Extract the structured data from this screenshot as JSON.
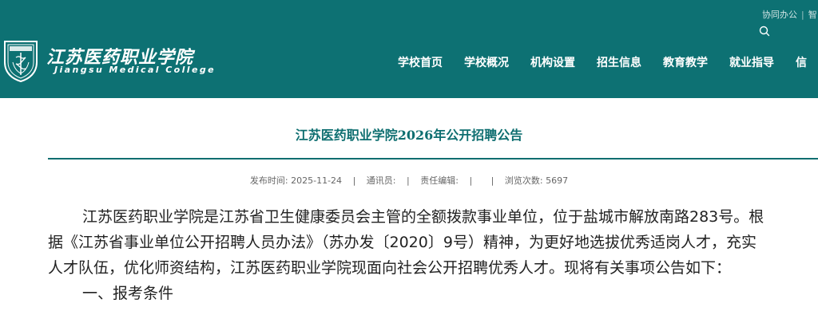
{
  "header": {
    "school_name_cn": "江苏医药职业学院",
    "school_name_en": "Jiangsu Medical College",
    "top_links": [
      "协同办公",
      "智"
    ],
    "nav": [
      "学校首页",
      "学校概况",
      "机构设置",
      "招生信息",
      "教育教学",
      "就业指导",
      "信"
    ]
  },
  "article": {
    "title": "江苏医药职业学院2026年公开招聘公告",
    "meta": {
      "publish_label": "发布时间:",
      "publish_date": "2025-11-24",
      "reporter_label": "通讯员:",
      "reporter": "",
      "editor_label": "责任编辑:",
      "editor": "",
      "views_label": "浏览次数:",
      "views": "5697"
    },
    "lines": [
      "江苏医药职业学院是江苏省卫生健康委员会主管的全额拨款事业单位，位于盐城市解放南路283号。根",
      "据《江苏省事业单位公开招聘人员办法》（苏办发〔2020〕9号）精神，为更好地选拔优秀适岗人才，充实",
      "人才队伍，优化师资结构，江苏医药职业学院现面向社会公开招聘优秀人才。现将有关事项公告如下：",
      "一、报考条件"
    ]
  },
  "colors": {
    "header_bg": "#0d7173",
    "title_color": "#0d6e70"
  }
}
